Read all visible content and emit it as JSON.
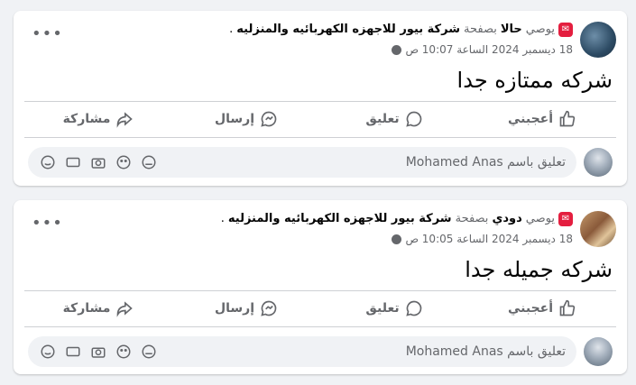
{
  "posts": [
    {
      "author": "حالا",
      "badge_prefix": "يوصي",
      "via": "بصفحة",
      "page": "شركة بيور للاجهزه الكهربائيه والمنزليه",
      "date": "18 ديسمبر 2024 الساعة 10:07 ص",
      "text": "شركه ممتازه جدا"
    },
    {
      "author": "دودي",
      "badge_prefix": "يوصي",
      "via": "بصفحة",
      "page": "شركة بيور للاجهزه الكهربائيه والمنزليه",
      "date": "18 ديسمبر 2024 الساعة 10:05 ص",
      "text": "شركه جميله جدا"
    }
  ],
  "actions": {
    "like": "أعجبني",
    "comment": "تعليق",
    "send": "إرسال",
    "share": "مشاركة"
  },
  "comment_placeholder": "تعليق باسم Mohamed Anas",
  "more_label": "•••",
  "badge_symbol": "✉",
  "colors": {
    "badge": "#e41e3f",
    "muted": "#65676b"
  },
  "icons": [
    "like-icon",
    "comment-icon",
    "send-icon",
    "share-icon",
    "sticker-icon",
    "gif-icon",
    "camera-icon",
    "emoji-icon",
    "avatar-sticker-icon",
    "globe-icon",
    "more-icon"
  ]
}
